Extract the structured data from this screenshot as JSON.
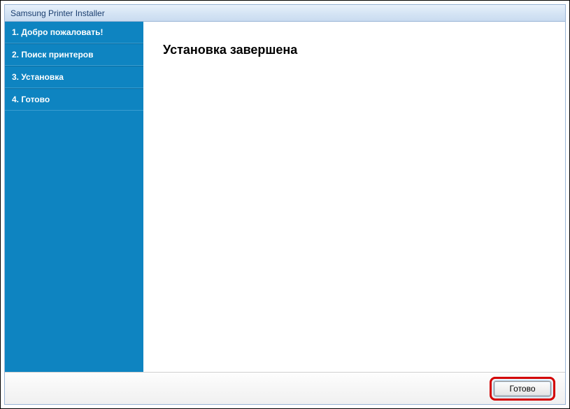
{
  "window": {
    "title": "Samsung Printer Installer"
  },
  "sidebar": {
    "steps": [
      {
        "label": "1. Добро пожаловать!"
      },
      {
        "label": "2. Поиск принтеров"
      },
      {
        "label": "3. Установка"
      },
      {
        "label": "4. Готово"
      }
    ],
    "active_index": 3
  },
  "main": {
    "heading": "Установка завершена"
  },
  "footer": {
    "done_label": "Готово"
  },
  "colors": {
    "sidebar_bg": "#0e84c1",
    "highlight": "#d30000"
  }
}
